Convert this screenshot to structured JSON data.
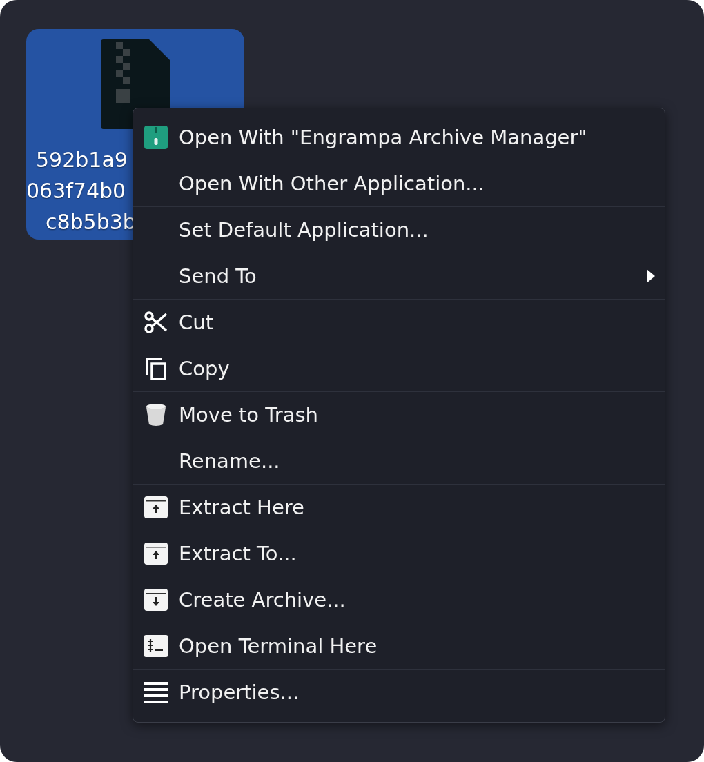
{
  "desktop_item": {
    "selected": true,
    "name_lines": [
      "592b1a9",
      "063f74b0",
      "c8b5b3b"
    ]
  },
  "context_menu": {
    "items": [
      {
        "kind": "app",
        "label": "Open With \"Engrampa Archive Manager\"",
        "separator_after": false
      },
      {
        "kind": "plain",
        "label": "Open With Other Application...",
        "separator_after": true
      },
      {
        "kind": "plain",
        "label": "Set Default Application...",
        "separator_after": true
      },
      {
        "kind": "submenu",
        "label": "Send To",
        "separator_after": true
      },
      {
        "kind": "cut",
        "label": "Cut",
        "separator_after": false
      },
      {
        "kind": "copy",
        "label": "Copy",
        "separator_after": true
      },
      {
        "kind": "trash",
        "label": "Move to Trash",
        "separator_after": true
      },
      {
        "kind": "plain",
        "label": "Rename...",
        "separator_after": true
      },
      {
        "kind": "extract",
        "label": "Extract Here",
        "separator_after": false
      },
      {
        "kind": "extract",
        "label": "Extract To...",
        "separator_after": false
      },
      {
        "kind": "create",
        "label": "Create Archive...",
        "separator_after": false
      },
      {
        "kind": "terminal",
        "label": "Open Terminal Here",
        "separator_after": true
      },
      {
        "kind": "properties",
        "label": "Properties...",
        "separator_after": false
      }
    ]
  }
}
